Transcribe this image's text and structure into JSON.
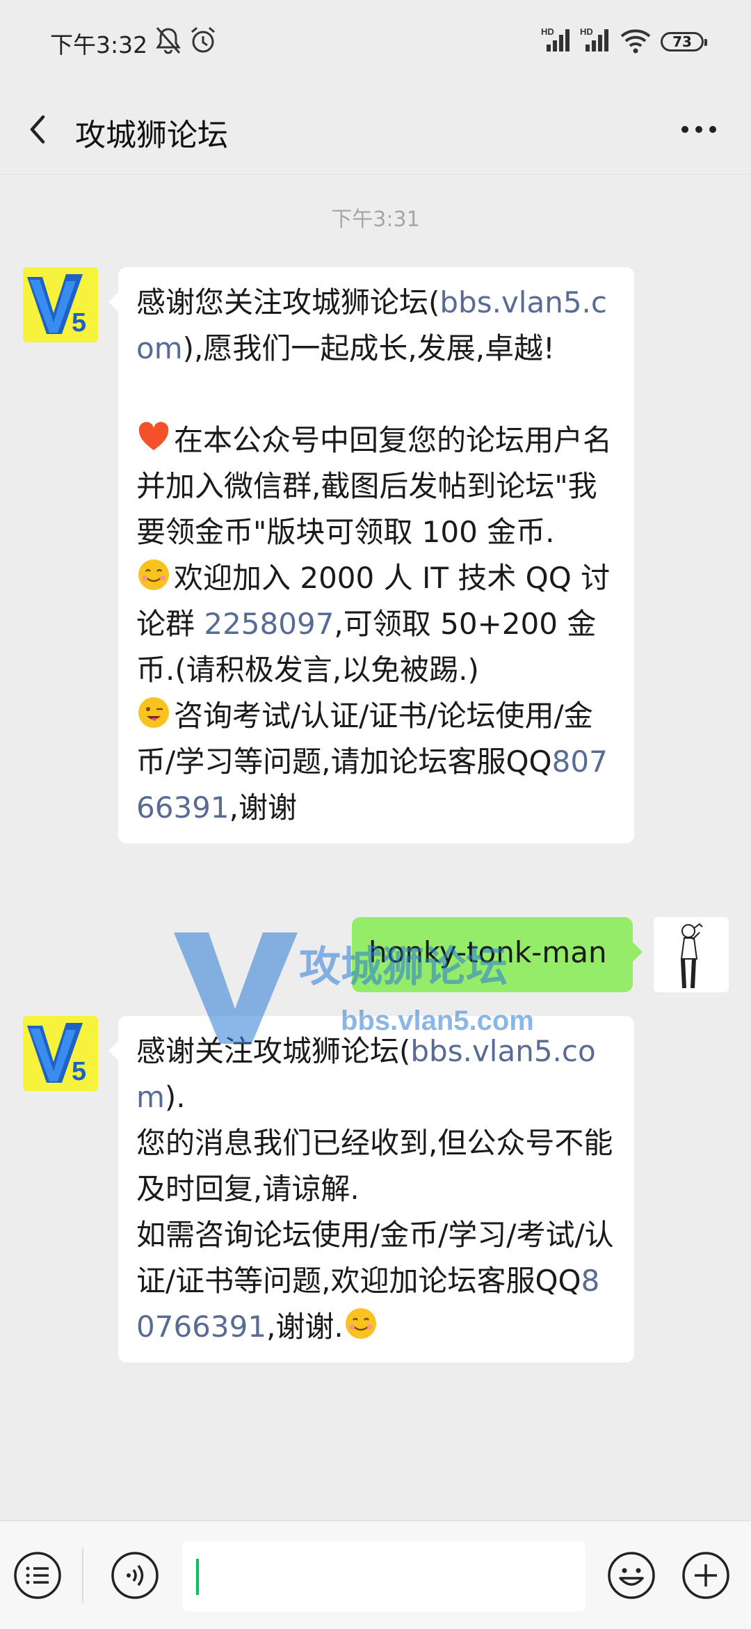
{
  "status_bar": {
    "time": "下午3:32",
    "battery": "73",
    "icons": [
      "mute-icon",
      "alarm-icon",
      "signal-hd-icon",
      "signal-hd-icon",
      "wifi-icon",
      "battery-icon"
    ]
  },
  "header": {
    "title": "攻城狮论坛",
    "back_icon": "back-chevron-icon",
    "more_icon": "more-dots-icon"
  },
  "chat": {
    "timestamp": "下午3:31",
    "messages": [
      {
        "sender": "official",
        "avatar": "V5",
        "paragraphs": [
          [
            "感谢您关注攻城狮论坛(",
            {
              "link": "bbs.vlan5.com"
            },
            "),愿我们一起成长,发展,卓越!"
          ],
          [],
          [
            {
              "emoji": "heart"
            },
            "在本公众号中回复您的论坛用户名并加入微信群,截图后发帖到论坛\"我要领金币\"版块可领取 100 金币."
          ],
          [
            {
              "emoji": "smile"
            },
            "欢迎加入 2000 人 IT 技术 QQ 讨论群 ",
            {
              "link": "2258097"
            },
            ",可领取 50+200 金币.(请积极发言,以免被踢.)"
          ],
          [
            {
              "emoji": "wink"
            },
            "咨询考试/认证/证书/论坛使用/金币/学习等问题,请加论坛客服QQ",
            {
              "link": "80766391"
            },
            ",谢谢"
          ]
        ]
      },
      {
        "sender": "me",
        "text": "honky-tonk-man"
      },
      {
        "sender": "official",
        "avatar": "V5",
        "paragraphs": [
          [
            "感谢关注攻城狮论坛(",
            {
              "link": "bbs.vlan5.com"
            },
            ")."
          ],
          [
            "您的消息我们已经收到,但公众号不能及时回复,请谅解."
          ],
          [
            "如需咨询论坛使用/金币/学习/考试/认证/证书等问题,欢迎加论坛客服QQ",
            {
              "link": "80766391"
            },
            ",谢谢.",
            {
              "emoji": "smile"
            }
          ]
        ]
      }
    ]
  },
  "watermark": {
    "title": "攻城狮论坛",
    "url": "bbs.vlan5.com",
    "logo": "V5"
  },
  "input_bar": {
    "menu_icon": "menu-list-icon",
    "voice_icon": "voice-icon",
    "emoji_icon": "emoji-icon",
    "plus_icon": "plus-icon",
    "value": ""
  },
  "colors": {
    "background": "#ededed",
    "link": "#576b95",
    "sent_bubble": "#95ec69",
    "caret": "#07c160",
    "watermark": "#2b7bd6"
  }
}
